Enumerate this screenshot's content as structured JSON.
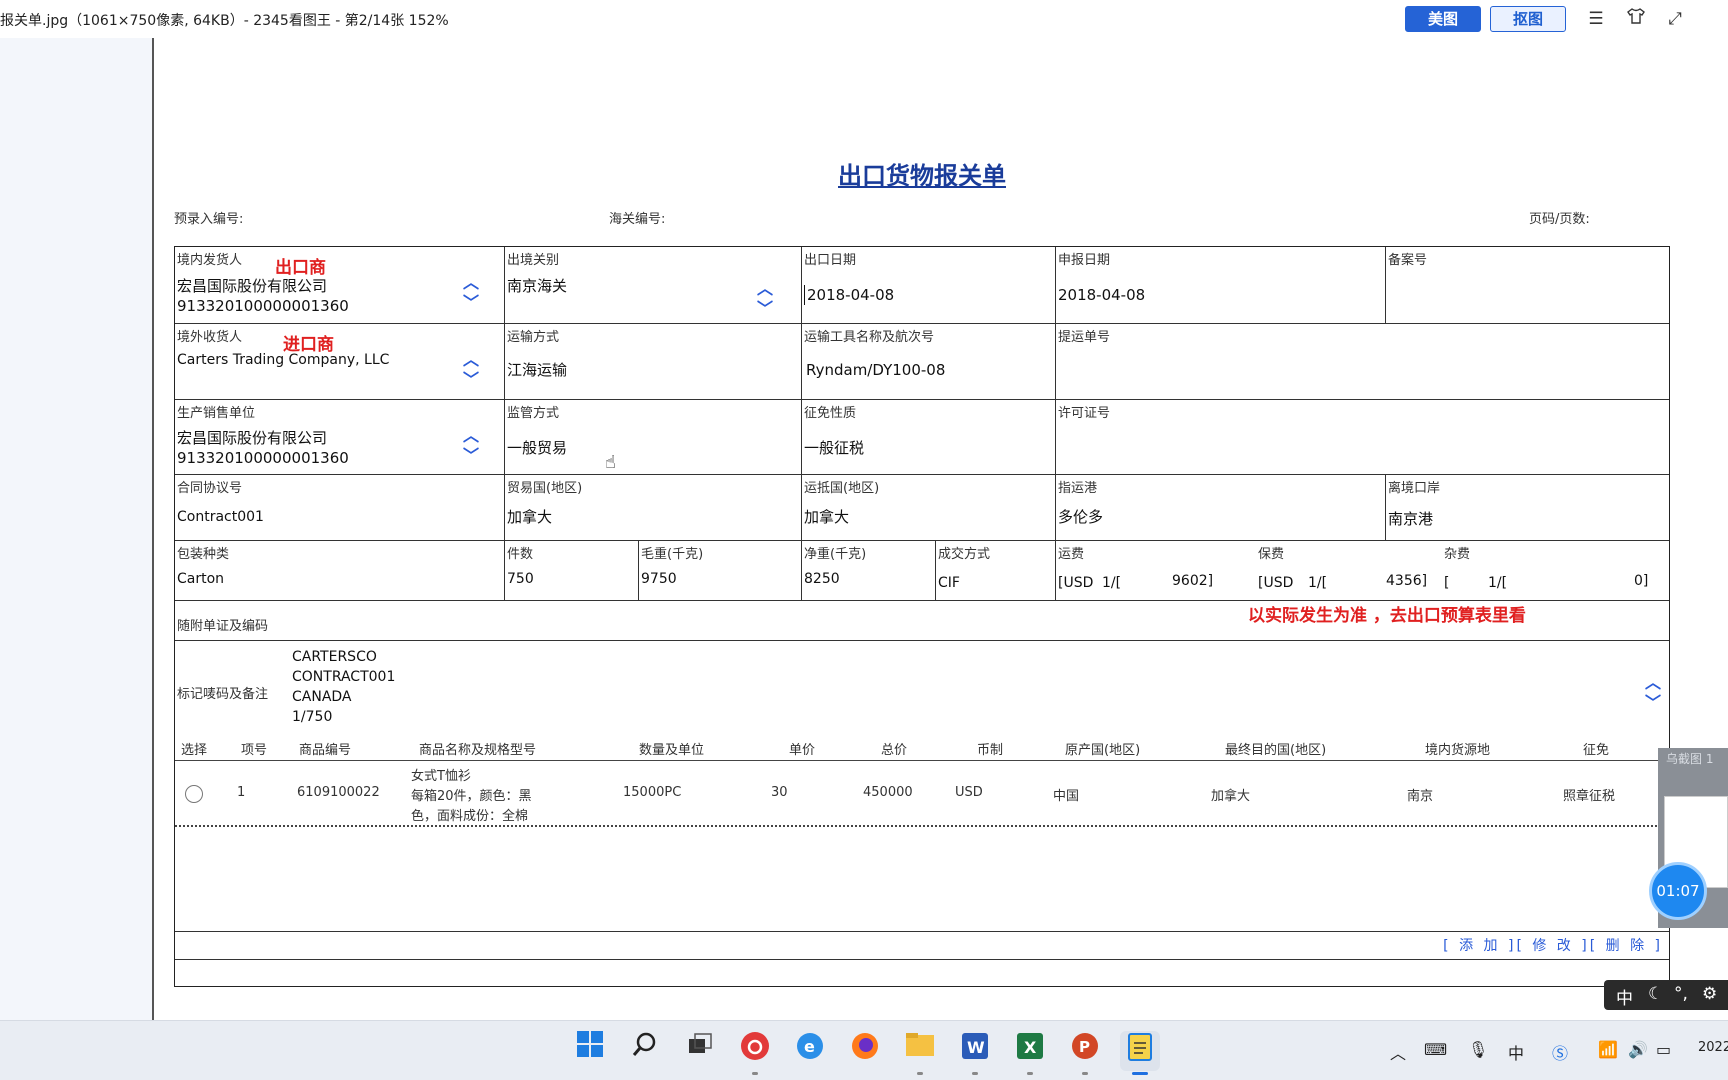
{
  "window": {
    "title": "报关单.jpg（1061×750像素, 64KB）- 2345看图王 - 第2/14张 152%",
    "btn_meitu": "美图",
    "btn_koutu": "抠图"
  },
  "doc": {
    "title": "出口货物报关单",
    "pre_entry_no": "预录入编号:",
    "customs_no": "海关编号:",
    "page_no": "页码/页数:",
    "r1": {
      "consignor_label": "境内发货人",
      "consignor_tag": "出口商",
      "consignor_name": "宏昌国际股份有限公司",
      "consignor_code": "913320100000001360",
      "exit_customs_label": "出境关别",
      "exit_customs": "南京海关",
      "export_date_label": "出口日期",
      "export_date": "2018-04-08",
      "declare_date_label": "申报日期",
      "declare_date": "2018-04-08",
      "record_no_label": "备案号"
    },
    "r2": {
      "consignee_label": "境外收货人",
      "consignee_tag": "进口商",
      "consignee_name": "Carters Trading Company, LLC",
      "transport_mode_label": "运输方式",
      "transport_mode": "江海运输",
      "vessel_label": "运输工具名称及航次号",
      "vessel": "Ryndam/DY100-08",
      "bl_no_label": "提运单号"
    },
    "r3": {
      "producer_label": "生产销售单位",
      "producer_name": "宏昌国际股份有限公司",
      "producer_code": "913320100000001360",
      "supervision_label": "监管方式",
      "supervision": "一般贸易",
      "tax_label": "征免性质",
      "tax": "一般征税",
      "license_label": "许可证号"
    },
    "r4": {
      "contract_label": "合同协议号",
      "contract": "Contract001",
      "trade_country_label": "贸易国(地区)",
      "trade_country": "加拿大",
      "dest_country_label": "运抵国(地区)",
      "dest_country": "加拿大",
      "dest_port_label": "指运港",
      "dest_port": "多伦多",
      "exit_port_label": "离境口岸",
      "exit_port": "南京港"
    },
    "r5": {
      "pack_label": "包装种类",
      "pack": "Carton",
      "pieces_label": "件数",
      "pieces": "750",
      "gross_label": "毛重(千克)",
      "gross": "9750",
      "net_label": "净重(千克)",
      "net": "8250",
      "deal_label": "成交方式",
      "deal": "CIF",
      "freight_label": "运费",
      "freight_cur": "[USD",
      "freight_sep": "1/[",
      "freight_amt": "9602]",
      "insurance_label": "保费",
      "insurance_cur": "[USD",
      "insurance_sep": "1/[",
      "insurance_amt": "4356]",
      "misc_label": "杂费",
      "misc_cur": "[",
      "misc_sep": "1/[",
      "misc_amt": "0]"
    },
    "r6": {
      "docs_label": "随附单证及编码",
      "note": "以实际发生为准 ，去出口预算表里看"
    },
    "r7": {
      "marks_label": "标记唛码及备注",
      "marks": [
        "CARTERSCO",
        "CONTRACT001",
        "CANADA",
        "1/750"
      ]
    },
    "items_header": [
      "选择",
      "项号",
      "商品编号",
      "商品名称及规格型号",
      "数量及单位",
      "单价",
      "总价",
      "币制",
      "原产国(地区)",
      "最终目的国(地区)",
      "境内货源地",
      "征免"
    ],
    "item": {
      "no": "1",
      "hs_code": "6109100022",
      "name_line1": "女式T恤衫",
      "name_line2": "每箱20件，颜色：黑",
      "name_line3": "色，面料成份：全棉",
      "qty": "15000PC",
      "unit_price": "30",
      "total": "450000",
      "currency": "USD",
      "origin": "中国",
      "destination": "加拿大",
      "source": "南京",
      "tax": "照章征税"
    },
    "actions": "[ 添 加 ][ 修 改 ][ 删 除 ]"
  },
  "overlay": {
    "thumb_caption": "乌截图 1",
    "timer": "01:07"
  },
  "ime": {
    "lang": "中"
  },
  "taskbar": {
    "apps": [
      "start-icon",
      "search-icon",
      "task-view-icon",
      "netease-music-icon",
      "edge-icon",
      "firefox-icon",
      "file-explorer-icon",
      "word-icon",
      "excel-icon",
      "powerpoint-icon",
      "notepad-icon"
    ],
    "tray_lang": "中",
    "clock": "2022"
  }
}
